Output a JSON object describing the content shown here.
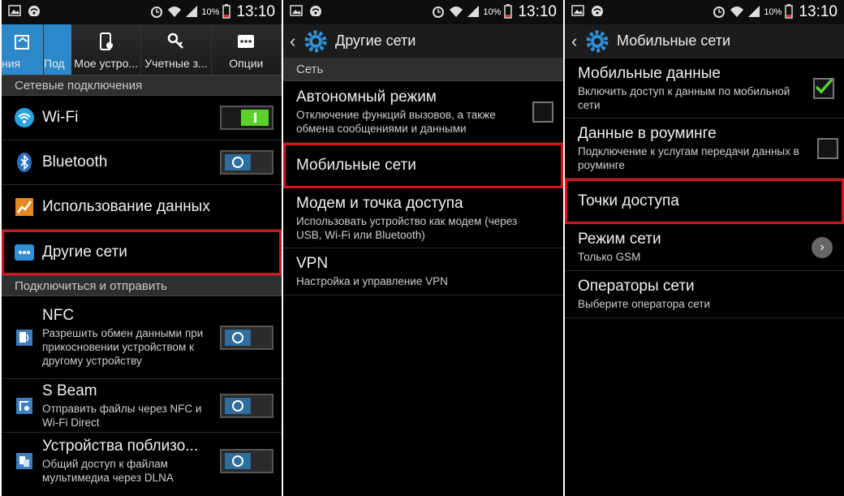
{
  "status": {
    "battery": "10%",
    "time": "13:10"
  },
  "panel1": {
    "tabs": [
      {
        "label": "ния"
      },
      {
        "label": "Под"
      },
      {
        "label": "Мое устро..."
      },
      {
        "label": "Учетные з..."
      },
      {
        "label": "Опции"
      }
    ],
    "section1": "Сетевые подключения",
    "items": [
      {
        "title": "Wi-Fi",
        "toggle": "on"
      },
      {
        "title": "Bluetooth",
        "toggle": "off"
      },
      {
        "title": "Использование данных"
      },
      {
        "title": "Другие сети"
      }
    ],
    "section2": "Подключиться и отправить",
    "items2": [
      {
        "title": "NFC",
        "sub": "Разрешить обмен данными при прикосновении устройством к другому устройству",
        "toggle": "off"
      },
      {
        "title": "S Beam",
        "sub": "Отправить файлы через NFC и Wi-Fi Direct",
        "toggle": "off"
      },
      {
        "title": "Устройства поблизо...",
        "sub": "Общий доступ к файлам мультимедиа через DLNA",
        "toggle": "off"
      }
    ]
  },
  "panel2": {
    "title": "Другие сети",
    "section": "Сеть",
    "items": [
      {
        "title": "Автономный режим",
        "sub": "Отключение функций вызовов, а также обмена сообщениями и данными"
      },
      {
        "title": "Мобильные сети"
      },
      {
        "title": "Модем и точка доступа",
        "sub": "Использовать устройство как модем (через USB, Wi-Fi или Bluetooth)"
      },
      {
        "title": "VPN",
        "sub": "Настройка и управление VPN"
      }
    ]
  },
  "panel3": {
    "title": "Мобильные сети",
    "items": [
      {
        "title": "Мобильные данные",
        "sub": "Включить доступ к данным по мобильной сети",
        "checked": true
      },
      {
        "title": "Данные в роуминге",
        "sub": "Подключение к услугам передачи данных в роуминге",
        "checked": false
      },
      {
        "title": "Точки доступа"
      },
      {
        "title": "Режим сети",
        "sub": "Только GSM"
      },
      {
        "title": "Операторы сети",
        "sub": "Выберите оператора сети"
      }
    ]
  },
  "colors": {
    "highlight": "#d8101c",
    "accent": "#2d88c9",
    "toggle_on": "#5bd12b"
  }
}
